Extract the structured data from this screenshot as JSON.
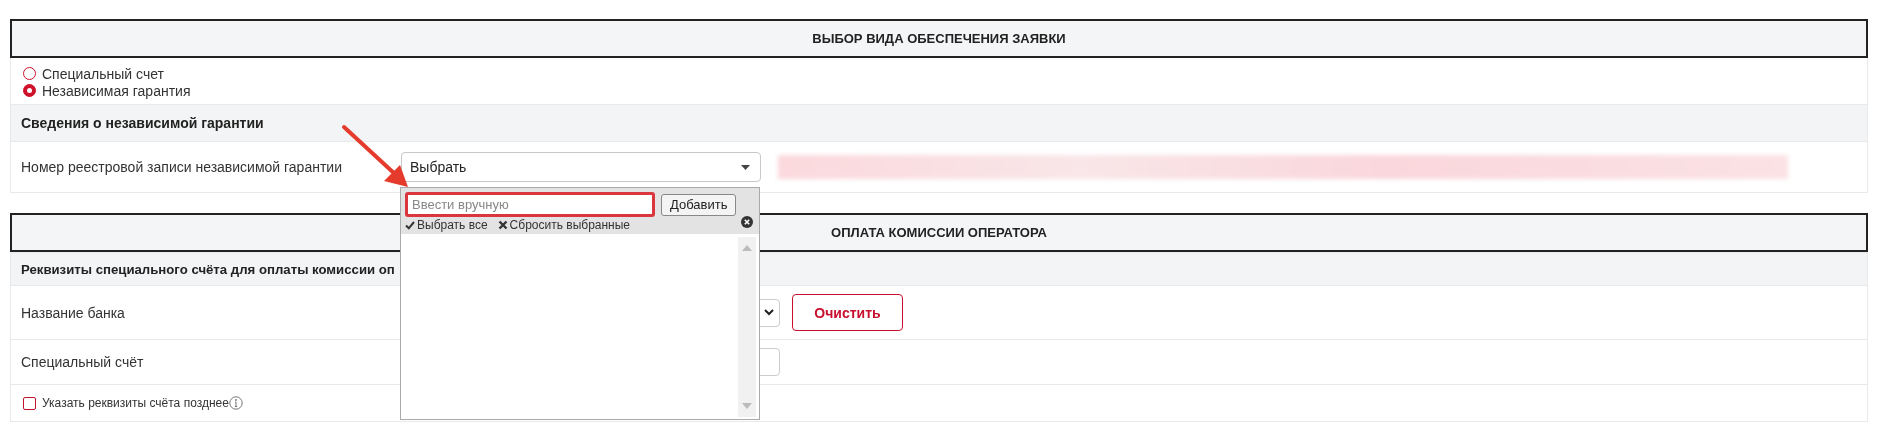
{
  "sections": [
    {
      "title": "ВЫБОР ВИДА ОБЕСПЕЧЕНИЯ ЗАЯВКИ",
      "options": [
        {
          "label": "Специальный счет",
          "selected": false
        },
        {
          "label": "Независимая гарантия",
          "selected": true
        }
      ],
      "subheader": "Сведения о независимой гарантии",
      "rows": [
        {
          "kind": "select",
          "label": "Номер реестровой записи независимой гарантии",
          "value": "Выбрать"
        }
      ]
    },
    {
      "title": "ОПЛАТА КОМИССИИ ОПЕРАТОРА",
      "subheader": "Реквизиты специального счёта для оплаты комиссии оп",
      "rows": [
        {
          "kind": "bank",
          "label": "Название банка",
          "button": "Очистить"
        },
        {
          "kind": "input",
          "label": "Специальный счёт"
        },
        {
          "kind": "checkbox",
          "label": "Указать реквизиты счёта позднее",
          "checked": false
        }
      ]
    }
  ],
  "dropdown": {
    "placeholder": "Ввести вручную",
    "add_button": "Добавить",
    "select_all": "Выбрать все",
    "reset": "Сбросить выбранные"
  }
}
